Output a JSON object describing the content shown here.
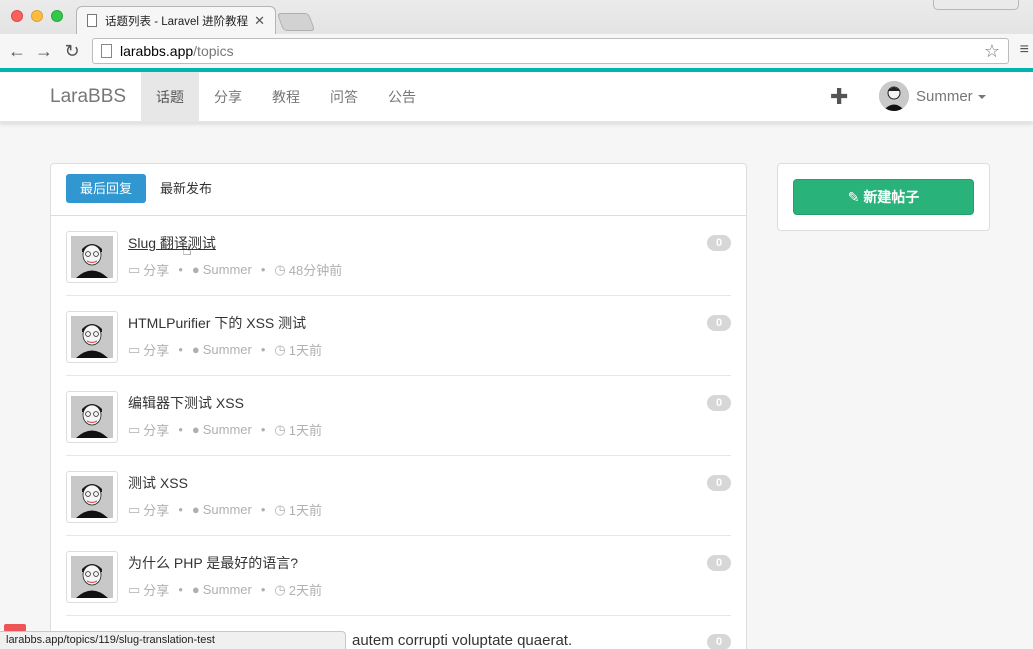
{
  "browser": {
    "tab_title": "话题列表 - Laravel 进阶教程",
    "tab_close": "✕",
    "url_host": "larabbs.app",
    "url_path": "/topics",
    "back": "←",
    "forward": "→",
    "reload": "↻",
    "star": "☆",
    "menu": "≡"
  },
  "navbar": {
    "brand": "LaraBBS",
    "items": [
      "话题",
      "分享",
      "教程",
      "问答",
      "公告"
    ],
    "active_index": 0,
    "plus": "✚",
    "user_name": "Summer"
  },
  "tabs": {
    "active": "最后回复",
    "other": "最新发布"
  },
  "topics": [
    {
      "title": "Slug 翻译测试",
      "category": "分享",
      "author": "Summer",
      "time": "48分钟前",
      "replies": "0"
    },
    {
      "title": "HTMLPurifier 下的 XSS 测试",
      "category": "分享",
      "author": "Summer",
      "time": "1天前",
      "replies": "0"
    },
    {
      "title": "编辑器下测试 XSS",
      "category": "分享",
      "author": "Summer",
      "time": "1天前",
      "replies": "0"
    },
    {
      "title": "测试 XSS",
      "category": "分享",
      "author": "Summer",
      "time": "1天前",
      "replies": "0"
    },
    {
      "title": "为什么 PHP 是最好的语言?",
      "category": "分享",
      "author": "Summer",
      "time": "2天前",
      "replies": "0"
    }
  ],
  "partial_topic": {
    "title": "autem corrupti voluptate quaerat.",
    "replies": "0"
  },
  "sidebar": {
    "new_button": "新建帖子",
    "pencil": "✎"
  },
  "status_bar": "larabbs.app/topics/119/slug-translation-test",
  "colors": {
    "accent": "#00b5ad",
    "primary": "#3097d1",
    "success": "#2ab27b"
  }
}
